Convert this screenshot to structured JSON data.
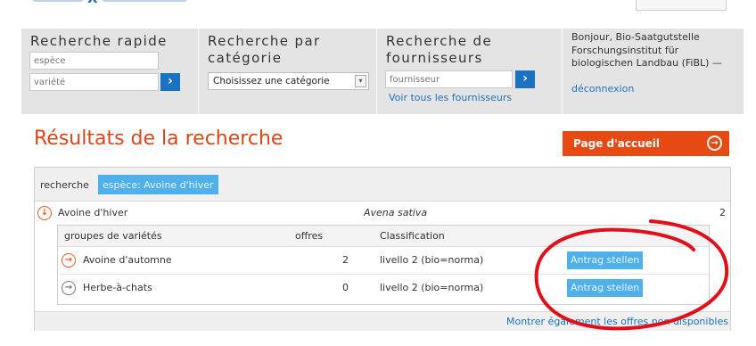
{
  "header": {
    "quick": {
      "title_line1": "Recherche rapide",
      "species_placeholder": "espèce",
      "variety_placeholder": "variété",
      "go_icon": "chevron-right-icon"
    },
    "category": {
      "title_line1": "Recherche par",
      "title_line2": "catégorie",
      "select_value": "Choisissez une catégorie"
    },
    "suppliers": {
      "title_line1": "Recherche de",
      "title_line2": "fournisseurs",
      "supplier_placeholder": "fournisseur",
      "all_link": "Voir tous les fournisseurs"
    },
    "user": {
      "greeting": "Bonjour, Bio-Saatgutstelle Forschungsinstitut für biologischen Landbau (FiBL) —",
      "logout": "déconnexion"
    }
  },
  "results": {
    "title": "Résultats de la recherche",
    "home_button": "Page d'accueil",
    "search_label": "recherche",
    "search_tag": "espèce: Avoine d'hiver",
    "species": {
      "name": "Avoine d'hiver",
      "latin": "Avena sativa",
      "count": "2"
    },
    "columns": {
      "groups": "groupes de variétés",
      "offers": "offres",
      "classification": "Classification"
    },
    "rows": [
      {
        "name": "Avoine d'automne",
        "offers": "2",
        "classification": "livello 2 (bio=norma)",
        "action": "Antrag stellen",
        "icon_color": "#e05a22"
      },
      {
        "name": "Herbe-à-chats",
        "offers": "0",
        "classification": "livello 2 (bio=norma)",
        "action": "Antrag stellen",
        "icon_color": "#777777"
      }
    ],
    "footer_link": "Montrer également les offres non disponibles"
  },
  "colors": {
    "accent_orange": "#e64a12",
    "link_blue": "#1e73be",
    "tag_blue": "#4fb0ea",
    "annotation_red": "#e0101a"
  }
}
